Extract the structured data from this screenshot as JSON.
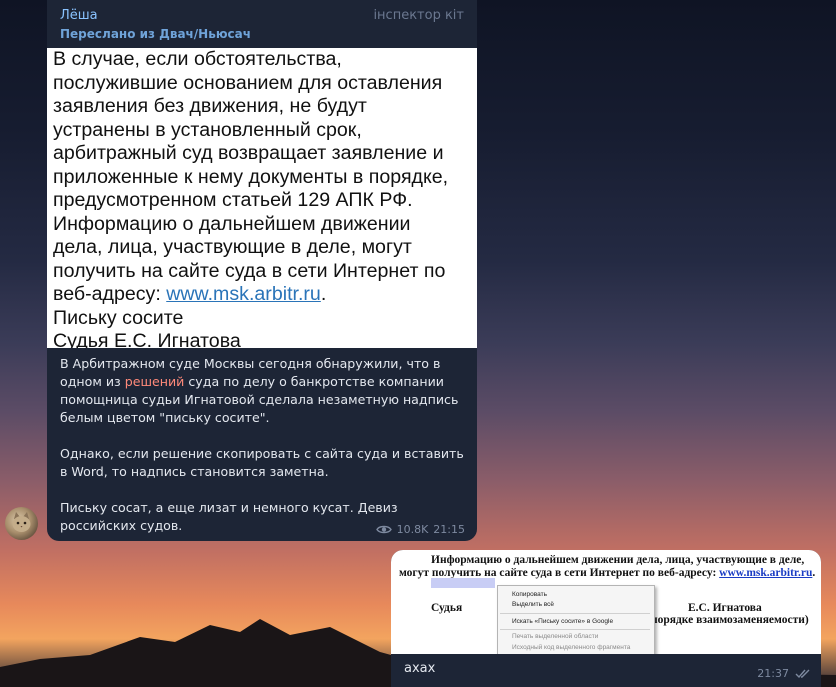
{
  "incoming": {
    "sender": "Лёша",
    "admin_title": "інспектор кіт",
    "forwarded": "Переслано из Двач/Ньюсач",
    "screenshot_lines": [
      "В случае, если обстоятельства,",
      "послужившие основанием для оставления",
      "заявления без движения, не будут",
      "устранены в установленный срок,",
      "арбитражный суд возвращает заявление и",
      "приложенные к нему документы в порядке,",
      "предусмотренном статьей 129 АПК РФ.",
      "Информацию о дальнейшем движении",
      "дела, лица, участвующие в деле, могут",
      "получить на сайте суда в сети Интернет по"
    ],
    "screenshot_addr_prefix": "веб-адресу: ",
    "screenshot_link": "www.msk.arbitr.ru",
    "screenshot_addr_suffix": ".",
    "screenshot_hidden": "Письку сосите",
    "screenshot_judge": "Судья Е.С. Игнатова",
    "caption_p1_before": "В Арбитражном суде Москвы сегодня обнаружили, что в одном из ",
    "caption_p1_link": "решений",
    "caption_p1_after": " суда по делу о банкротстве компании помощница судьи Игнатовой сделала незаметную надпись белым цветом \"письку сосите\".",
    "caption_p2": "Однако, если решение скопировать с сайта суда и вставить в Word, то надпись становится заметна.",
    "caption_p3": "Письку сосат, а еще лизат и немного кусат. Девиз российских судов.",
    "views": "10.8K",
    "time": "21:15"
  },
  "outgoing": {
    "doc_line1": "Информацию о дальнейшем движении дела, лица, участвующие в деле,",
    "doc_line2": "могут получить на сайте суда в сети Интернет по веб-адресу: ",
    "doc_link": "www.msk.arbitr.ru",
    "doc_line2_end": ".",
    "doc_judge_label": "Судья",
    "doc_judge_name": "Е.С. Игнатова",
    "doc_order": "порядке взаимозаменяемости)",
    "context_menu": [
      "Копировать",
      "Выделить всё",
      "Искать «Письку сосите» в Google",
      "Печать выделенной области",
      "Исходный код выделенного фрагмента"
    ],
    "text": "ахах",
    "time": "21:37"
  },
  "colors": {
    "bubble": "#1d2536",
    "sender": "#8ac3ff",
    "link": "#ff8a7a",
    "meta": "#7e8aa0"
  }
}
